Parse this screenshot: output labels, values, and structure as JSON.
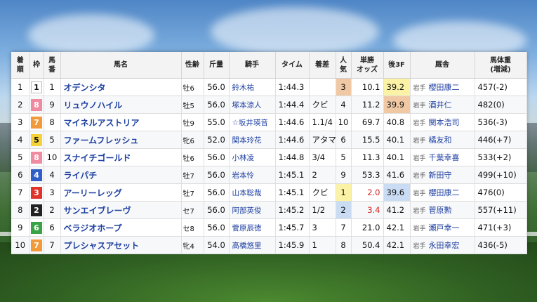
{
  "headers": {
    "rank": [
      "着",
      "順"
    ],
    "waku": "枠",
    "horse_num": [
      "馬",
      "番"
    ],
    "horse_name": "馬名",
    "sex_age": "性齢",
    "weight_carried": "斤量",
    "jockey": "騎手",
    "time": "タイム",
    "margin": "着差",
    "popularity": [
      "人",
      "気"
    ],
    "odds": [
      "単勝",
      "オッズ"
    ],
    "last3f": "後3F",
    "trainer": "厩舎",
    "body_weight": [
      "馬体重",
      "(増減)"
    ]
  },
  "waku_colors": {
    "1": {
      "bg": "#ffffff",
      "fg": "#111111"
    },
    "2": {
      "bg": "#222222",
      "fg": "#ffffff"
    },
    "3": {
      "bg": "#e0352b",
      "fg": "#ffffff"
    },
    "4": {
      "bg": "#2f5fc7",
      "fg": "#ffffff"
    },
    "5": {
      "bg": "#f5d23a",
      "fg": "#111111"
    },
    "6": {
      "bg": "#3aa346",
      "fg": "#ffffff"
    },
    "7": {
      "bg": "#f29a3a",
      "fg": "#ffffff"
    },
    "8": {
      "bg": "#f08aa0",
      "fg": "#ffffff"
    }
  },
  "rows": [
    {
      "rank": "1",
      "waku": "1",
      "num": "1",
      "name": "オデンシタ",
      "sex_age": "牡6",
      "kinryo": "56.0",
      "jockey": "鈴木祐",
      "time": "1:44.3",
      "margin": "",
      "pop": "3",
      "odds": "10.1",
      "odds_red": false,
      "last3f": "39.2",
      "loc": "岩手",
      "trainer": "櫻田康二",
      "bw": "457(-2)",
      "pop_hl": "or",
      "f3_hl": "ye"
    },
    {
      "rank": "2",
      "waku": "8",
      "num": "9",
      "name": "リュウノハイル",
      "sex_age": "牡5",
      "kinryo": "56.0",
      "jockey": "塚本涼人",
      "time": "1:44.4",
      "margin": "クビ",
      "pop": "4",
      "odds": "11.2",
      "odds_red": false,
      "last3f": "39.9",
      "loc": "岩手",
      "trainer": "酒井仁",
      "bw": "482(0)",
      "pop_hl": "",
      "f3_hl": "or"
    },
    {
      "rank": "3",
      "waku": "7",
      "num": "8",
      "name": "マイネルアストリア",
      "sex_age": "牡9",
      "kinryo": "55.0",
      "jockey": "☆坂井瑛音",
      "time": "1:44.6",
      "margin": "1.1/4",
      "pop": "10",
      "odds": "69.7",
      "odds_red": false,
      "last3f": "40.8",
      "loc": "岩手",
      "trainer": "関本浩司",
      "bw": "536(-3)",
      "pop_hl": "",
      "f3_hl": ""
    },
    {
      "rank": "4",
      "waku": "5",
      "num": "5",
      "name": "ファームフレッシュ",
      "sex_age": "牝6",
      "kinryo": "52.0",
      "jockey": "関本玲花",
      "time": "1:44.6",
      "margin": "アタマ",
      "pop": "6",
      "odds": "15.5",
      "odds_red": false,
      "last3f": "40.1",
      "loc": "岩手",
      "trainer": "橘友和",
      "bw": "446(+7)",
      "pop_hl": "",
      "f3_hl": ""
    },
    {
      "rank": "5",
      "waku": "8",
      "num": "10",
      "name": "スナイチゴールド",
      "sex_age": "牡6",
      "kinryo": "56.0",
      "jockey": "小林凌",
      "time": "1:44.8",
      "margin": "3/4",
      "pop": "5",
      "odds": "11.3",
      "odds_red": false,
      "last3f": "40.1",
      "loc": "岩手",
      "trainer": "千葉幸喜",
      "bw": "533(+2)",
      "pop_hl": "",
      "f3_hl": ""
    },
    {
      "rank": "6",
      "waku": "4",
      "num": "4",
      "name": "ライパチ",
      "sex_age": "牡7",
      "kinryo": "56.0",
      "jockey": "岩本怜",
      "time": "1:45.1",
      "margin": "2",
      "pop": "9",
      "odds": "53.3",
      "odds_red": false,
      "last3f": "41.6",
      "loc": "岩手",
      "trainer": "新田守",
      "bw": "499(+10)",
      "pop_hl": "",
      "f3_hl": ""
    },
    {
      "rank": "7",
      "waku": "3",
      "num": "3",
      "name": "アーリーレッグ",
      "sex_age": "牡7",
      "kinryo": "56.0",
      "jockey": "山本聡哉",
      "time": "1:45.1",
      "margin": "クビ",
      "pop": "1",
      "odds": "2.0",
      "odds_red": true,
      "last3f": "39.6",
      "loc": "岩手",
      "trainer": "櫻田康二",
      "bw": "476(0)",
      "pop_hl": "ye",
      "f3_hl": "bl"
    },
    {
      "rank": "8",
      "waku": "2",
      "num": "2",
      "name": "サンエイブレーヴ",
      "sex_age": "セ7",
      "kinryo": "56.0",
      "jockey": "阿部英俊",
      "time": "1:45.2",
      "margin": "1/2",
      "pop": "2",
      "odds": "3.4",
      "odds_red": true,
      "last3f": "41.2",
      "loc": "岩手",
      "trainer": "菅原勲",
      "bw": "557(+11)",
      "pop_hl": "bl",
      "f3_hl": ""
    },
    {
      "rank": "9",
      "waku": "6",
      "num": "6",
      "name": "ベラジオホープ",
      "sex_age": "セ8",
      "kinryo": "56.0",
      "jockey": "菅原辰徳",
      "time": "1:45.7",
      "margin": "3",
      "pop": "7",
      "odds": "21.0",
      "odds_red": false,
      "last3f": "42.1",
      "loc": "岩手",
      "trainer": "瀬戸幸一",
      "bw": "471(+3)",
      "pop_hl": "",
      "f3_hl": ""
    },
    {
      "rank": "10",
      "waku": "7",
      "num": "7",
      "name": "プレシャスアセット",
      "sex_age": "牝4",
      "kinryo": "54.0",
      "jockey": "高橋悠里",
      "time": "1:45.9",
      "margin": "1",
      "pop": "8",
      "odds": "50.4",
      "odds_red": false,
      "last3f": "42.1",
      "loc": "岩手",
      "trainer": "永田幸宏",
      "bw": "436(-5)",
      "pop_hl": "",
      "f3_hl": ""
    }
  ]
}
